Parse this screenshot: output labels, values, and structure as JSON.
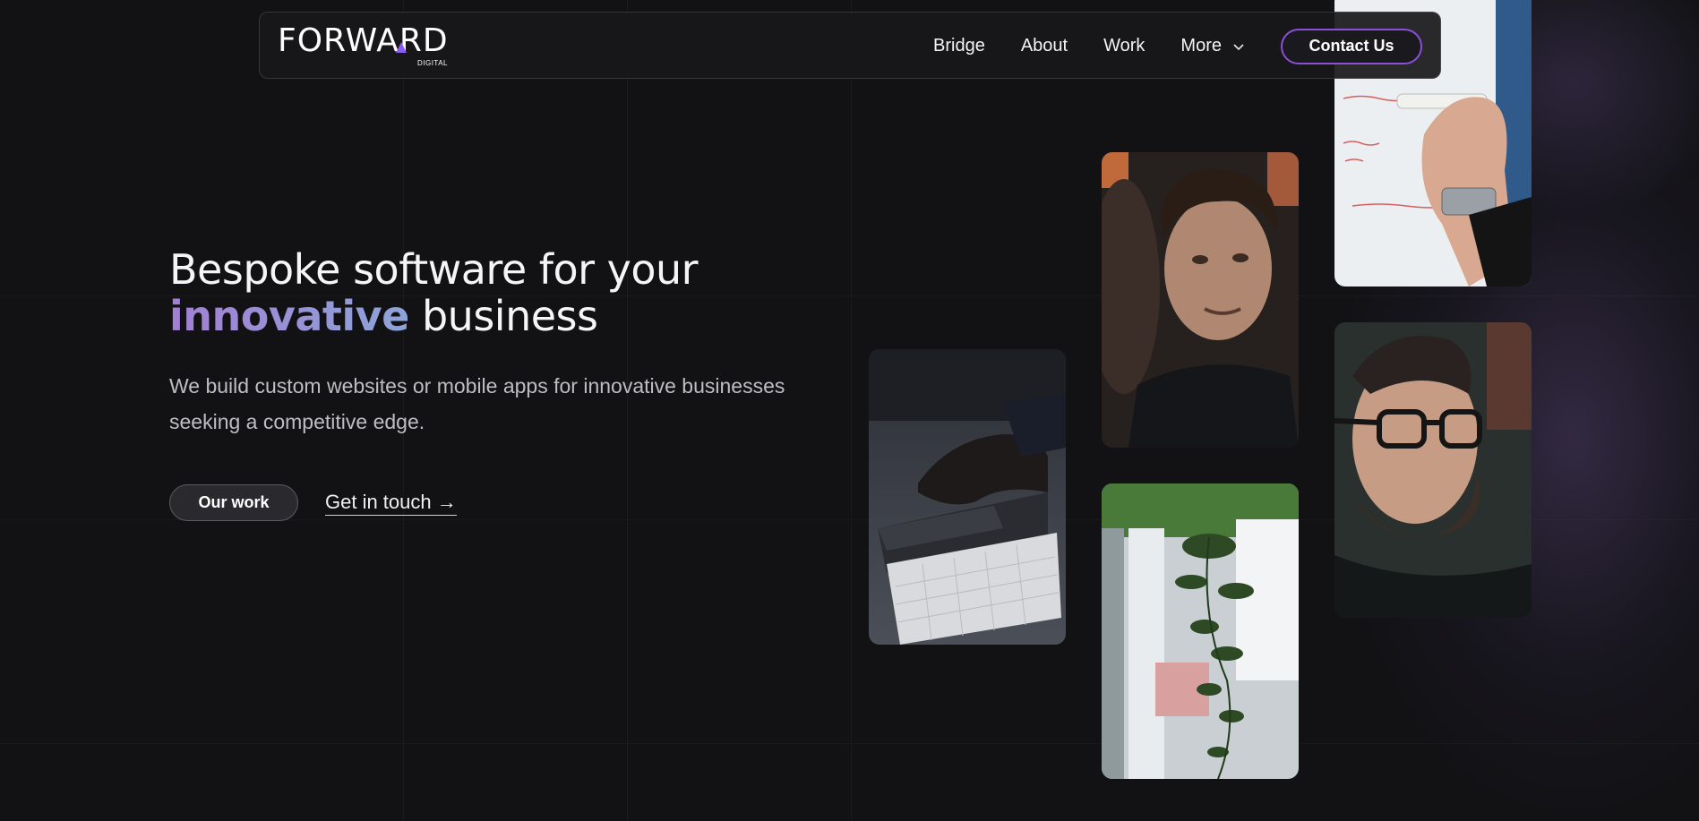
{
  "brand": {
    "logo_text": "FORWARD",
    "logo_sub": "DIGITAL"
  },
  "nav": {
    "items": [
      {
        "label": "Bridge"
      },
      {
        "label": "About"
      },
      {
        "label": "Work"
      },
      {
        "label": "More"
      }
    ],
    "contact_label": "Contact Us"
  },
  "hero": {
    "title_line1": "Bespoke software for your",
    "title_highlight": "innovative",
    "title_rest": "business",
    "subtitle": "We build custom websites or mobile apps for innovative businesses seeking a competitive edge.",
    "primary_cta": "Our work",
    "secondary_cta": "Get in touch →"
  },
  "colors": {
    "background": "#121214",
    "accent": "#8b4fd8",
    "highlight_start": "#a37fd4",
    "highlight_end": "#8da4d8"
  },
  "photos": [
    {
      "subject": "hand-on-trackpad-photo"
    },
    {
      "subject": "man-smiling-photo"
    },
    {
      "subject": "hanging-plant-photo"
    },
    {
      "subject": "hand-writing-on-whiteboard-photo"
    },
    {
      "subject": "man-with-glasses-photo"
    }
  ]
}
